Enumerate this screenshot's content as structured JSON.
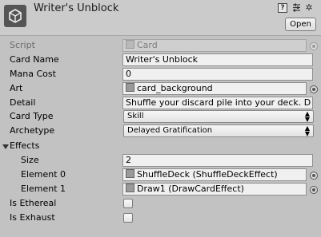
{
  "header": {
    "title": "Writer's Unblock",
    "open_label": "Open",
    "icons": [
      "unity-logo-icon",
      "help-icon",
      "preset-icon",
      "settings-icon"
    ]
  },
  "fields": {
    "script": {
      "label": "Script",
      "value": "Card"
    },
    "card_name": {
      "label": "Card Name",
      "value": "Writer's Unblock"
    },
    "mana_cost": {
      "label": "Mana Cost",
      "value": "0"
    },
    "art": {
      "label": "Art",
      "value": "card_background"
    },
    "detail": {
      "label": "Detail",
      "value": "Shuffle your discard pile into your deck. D"
    },
    "card_type": {
      "label": "Card Type",
      "value": "Skill"
    },
    "archetype": {
      "label": "Archetype",
      "value": "Delayed Gratification"
    },
    "effects": {
      "label": "Effects",
      "size_label": "Size",
      "size_value": "2",
      "elements": [
        {
          "label": "Element 0",
          "value": "ShuffleDeck (ShuffleDeckEffect)"
        },
        {
          "label": "Element 1",
          "value": "Draw1 (DrawCardEffect)"
        }
      ]
    },
    "is_ethereal": {
      "label": "Is Ethereal",
      "checked": false
    },
    "is_exhaust": {
      "label": "Is Exhaust",
      "checked": false
    }
  },
  "colors": {
    "background": "#c2c2c2",
    "header": "#cbcbcb",
    "field": "#f0f0f0"
  }
}
